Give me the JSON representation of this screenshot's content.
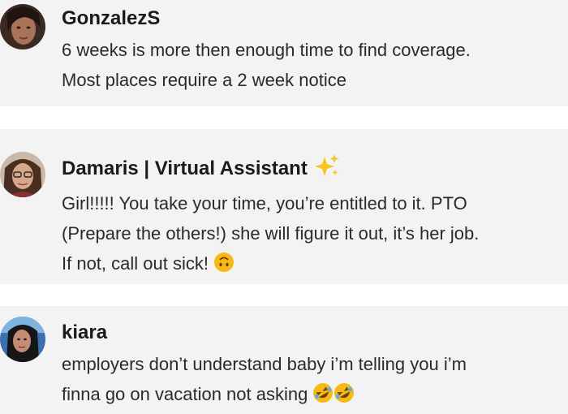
{
  "comments": [
    {
      "username": "GonzalezS",
      "lines": [
        "6 weeks is more then enough time to find coverage.",
        "Most places require a 2 week notice"
      ]
    },
    {
      "username": "Damaris | Virtual Assistant",
      "username_emoji": "sparkles-icon",
      "lines": [
        "Girl!!!!! You take your time, you’re entitled to it. PTO",
        "(Prepare the others!) she will figure it out, it’s her job.",
        "If not, call out sick!"
      ],
      "trailing_emoji": "upside-down-face-icon"
    },
    {
      "username": "kiara",
      "lines": [
        "employers don’t understand baby i’m telling you i’m",
        "finna go on vacation not asking"
      ],
      "trailing_emoji": "rolling-on-floor-laughing-icon x2"
    }
  ],
  "colors": {
    "card_background": "#f3f3f3",
    "username": "#1a1a1a",
    "text": "#2a2a2a",
    "emoji_yellow": "#f7b917"
  }
}
